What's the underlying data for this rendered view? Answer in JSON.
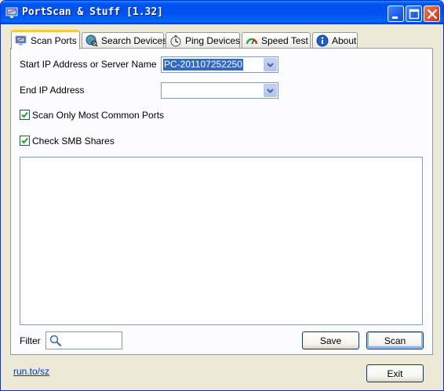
{
  "window": {
    "title": "PortScan & Stuff [1.32]"
  },
  "tabs": [
    {
      "label": "Scan Ports",
      "icon": "monitor-network-icon",
      "active": true
    },
    {
      "label": "Search Devices",
      "icon": "globe-search-icon",
      "active": false
    },
    {
      "label": "Ping Devices",
      "icon": "stopwatch-icon",
      "active": false
    },
    {
      "label": "Speed Test",
      "icon": "gauge-icon",
      "active": false
    },
    {
      "label": "About",
      "icon": "info-icon",
      "active": false
    }
  ],
  "form": {
    "start_ip_label": "Start IP Address or Server Name",
    "start_ip_value": "PC-201107252250",
    "end_ip_label": "End IP Address",
    "end_ip_value": "",
    "common_ports_label": "Scan Only Most Common Ports",
    "common_ports_checked": true,
    "smb_label": "Check SMB Shares",
    "smb_checked": true
  },
  "filter": {
    "label": "Filter",
    "value": ""
  },
  "buttons": {
    "save": "Save",
    "scan": "Scan",
    "exit": "Exit"
  },
  "footer": {
    "link": "run.to/sz"
  },
  "colors": {
    "titlebar": "#0054e3",
    "active_tab_accent": "#ffc83c",
    "selection": "#316ac5",
    "link": "#0033cc"
  }
}
